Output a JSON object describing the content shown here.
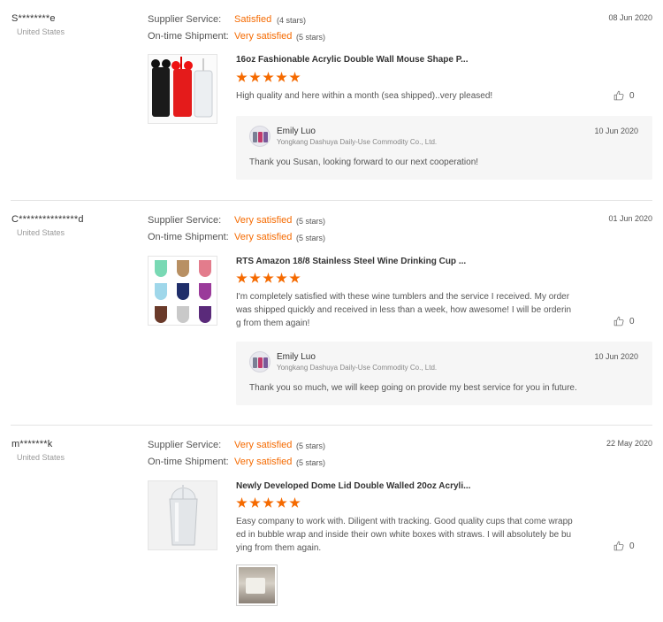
{
  "labels": {
    "supplier_service": "Supplier Service:",
    "ontime_shipment": "On-time Shipment:"
  },
  "colors": {
    "accent": "#f56a00",
    "reply_bg": "#f6f6f6"
  },
  "icons": {
    "like": "thumbs-up-icon",
    "star": "star-icon"
  },
  "reviews": [
    {
      "buyer": "S********e",
      "country": "United States",
      "date": "08 Jun 2020",
      "supplier_service": {
        "text": "Satisfied",
        "stars": "(4 stars)"
      },
      "ontime_shipment": {
        "text": "Very satisfied",
        "stars": "(5 stars)"
      },
      "product_title": "16oz Fashionable Acrylic Double Wall Mouse Shape P...",
      "rating": 5,
      "comment": "High quality and here within a month (sea shipped)..very pleased!",
      "likes": "0",
      "reply": {
        "name": "Emily Luo",
        "company": "Yongkang Dashuya Daily-Use Commodity Co., Ltd.",
        "date": "10 Jun 2020",
        "text": "Thank you Susan, looking forward to our next cooperation!"
      }
    },
    {
      "buyer": "C***************d",
      "country": "United States",
      "date": "01 Jun 2020",
      "supplier_service": {
        "text": "Very satisfied",
        "stars": "(5 stars)"
      },
      "ontime_shipment": {
        "text": "Very satisfied",
        "stars": "(5 stars)"
      },
      "product_title": "RTS Amazon 18/8 Stainless Steel Wine Drinking Cup ...",
      "rating": 5,
      "comment": "I'm completely satisfied with these wine tumblers and the service I received. My order was shipped quickly and received in less than a week, how awesome! I will be ordering from them again!",
      "likes": "0",
      "reply": {
        "name": "Emily Luo",
        "company": "Yongkang Dashuya Daily-Use Commodity Co., Ltd.",
        "date": "10 Jun 2020",
        "text": "Thank you so much, we will keep going on provide my best service for you in future."
      }
    },
    {
      "buyer": "m*******k",
      "country": "United States",
      "date": "22 May 2020",
      "supplier_service": {
        "text": "Very satisfied",
        "stars": "(5 stars)"
      },
      "ontime_shipment": {
        "text": "Very satisfied",
        "stars": "(5 stars)"
      },
      "product_title": "Newly Developed Dome Lid Double Walled 20oz Acryli...",
      "rating": 5,
      "comment": "Easy company to work with. Diligent with tracking. Good quality cups that come wrapped in bubble wrap and inside their own white boxes with straws. I will absolutely be buying from them again.",
      "likes": "0"
    }
  ]
}
